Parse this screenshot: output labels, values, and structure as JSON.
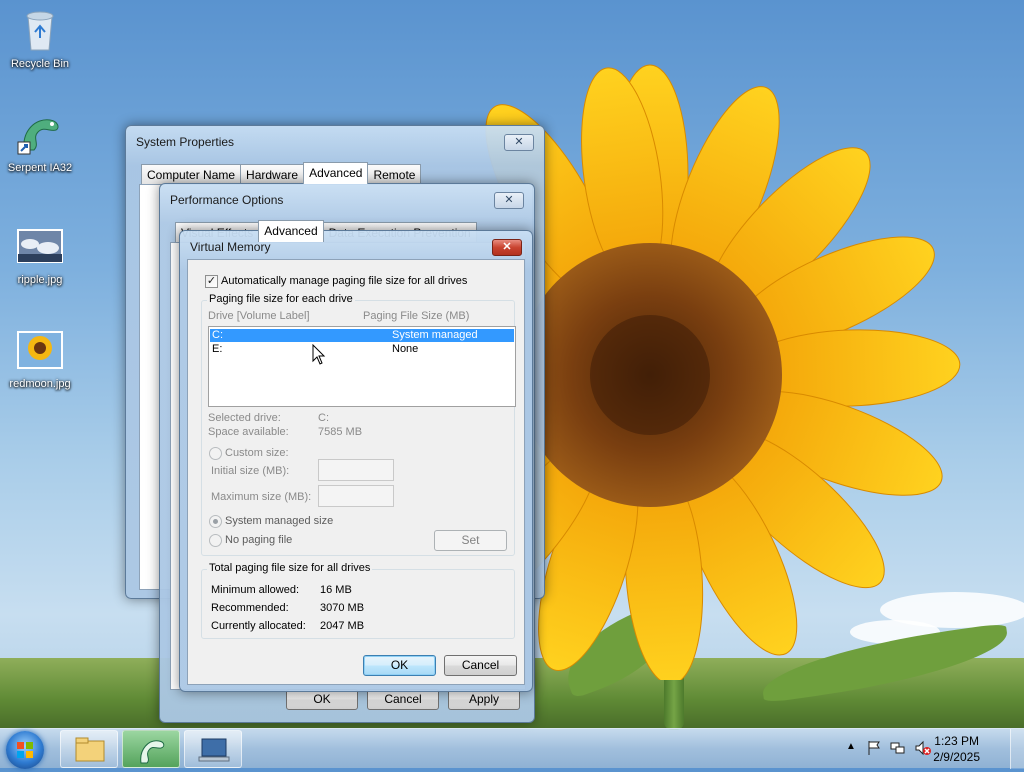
{
  "desktop": {
    "icons": [
      {
        "label": "Recycle Bin",
        "icon": "recycle-bin-icon"
      },
      {
        "label": "Serpent IA32",
        "icon": "serpent-icon"
      },
      {
        "label": "ripple.jpg",
        "icon": "image-file-icon"
      },
      {
        "label": "redmoon.jpg",
        "icon": "image-file-icon"
      }
    ]
  },
  "system_properties": {
    "title": "System Properties",
    "close": "✕",
    "tabs": [
      "Computer Name",
      "Hardware",
      "Advanced",
      "Remote"
    ],
    "active_tab": "Advanced"
  },
  "performance_options": {
    "title": "Performance Options",
    "close": "✕",
    "tabs": [
      "Visual Effects",
      "Advanced",
      "Data Execution Prevention"
    ],
    "buttons": {
      "ok": "OK",
      "cancel": "Cancel",
      "apply": "Apply"
    }
  },
  "virtual_memory": {
    "title": "Virtual Memory",
    "close": "✕",
    "auto_manage": {
      "label": "Automatically manage paging file size for all drives",
      "checked": true
    },
    "paging_group": {
      "title": "Paging file size for each drive",
      "col_drive": "Drive  [Volume Label]",
      "col_size": "Paging File Size (MB)",
      "rows": [
        {
          "drive": "C:",
          "size": "System managed",
          "selected": true
        },
        {
          "drive": "E:",
          "size": "None",
          "selected": false
        }
      ],
      "selected_drive_label": "Selected drive:",
      "selected_drive_value": "C:",
      "space_available_label": "Space available:",
      "space_available_value": "7585 MB",
      "custom_size": "Custom size:",
      "initial_size": "Initial size (MB):",
      "maximum_size": "Maximum size (MB):",
      "system_managed": "System managed size",
      "no_paging": "No paging file",
      "set_button": "Set"
    },
    "total_group": {
      "title": "Total paging file size for all drives",
      "min_label": "Minimum allowed:",
      "min_value": "16 MB",
      "rec_label": "Recommended:",
      "rec_value": "3070 MB",
      "alloc_label": "Currently allocated:",
      "alloc_value": "2047 MB"
    },
    "buttons": {
      "ok": "OK",
      "cancel": "Cancel"
    }
  },
  "taskbar": {
    "time": "1:23 PM",
    "date": "2/9/2025",
    "tray_icons": [
      "show-hidden-icons-icon",
      "action-center-flag-icon",
      "network-icon",
      "volume-muted-icon"
    ]
  }
}
